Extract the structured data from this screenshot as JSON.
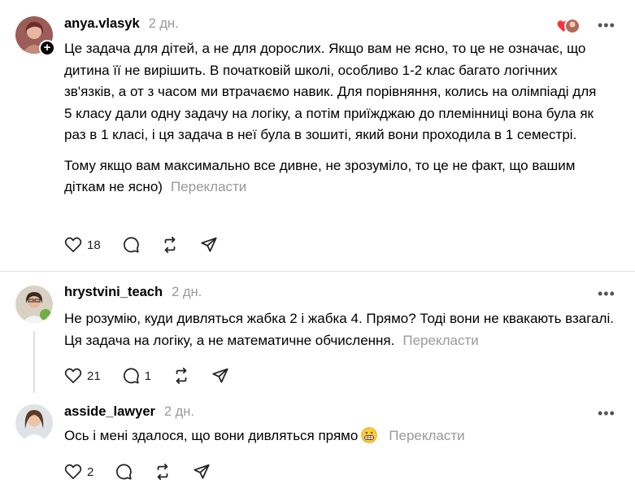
{
  "posts": [
    {
      "username": "anya.vlasyk",
      "time": "2 дн.",
      "paragraphs": [
        "Це задача для дітей, а не для дорослих. Якщо вам не ясно, то це не означає, що дитина її не вирішить. В початковій школі, особливо 1-2 клас багато логічних зв'язків, а от з часом ми втрачаємо навик. Для порівняння, колись на олімпіаді для 5 класу дали одну задачу на логіку, а потім приїжджаю до племінниці вона була як раз в 1 класі, і ця задача в неї була в зошиті, який вони проходила в 1 семестрі.",
        "Тому якщо вам максимально все дивне, не зрозуміло, то це не факт, що вашим діткам не ясно)"
      ],
      "translate": "Перекласти",
      "likes": "18",
      "replies": "",
      "more_icon": "more-horizontal-icon"
    },
    {
      "username": "hrystvini_teach",
      "time": "2 дн.",
      "paragraphs": [
        "Не розумію, куди дивляться жабка 2 і жабка 4. Прямо? Тоді вони не квакають взагалі. Ця задача на логіку, а не математичне обчислення."
      ],
      "translate": "Перекласти",
      "likes": "21",
      "replies": "1"
    },
    {
      "username": "asside_lawyer",
      "time": "2 дн.",
      "paragraphs": [
        "Ось і мені здалося, що вони дивляться прямо"
      ],
      "translate": "Перекласти",
      "likes": "2",
      "replies": ""
    }
  ],
  "colors": {
    "text": "#000000",
    "muted": "#999999",
    "divider": "#dcdcdc",
    "liked_heart": "#ff3040"
  },
  "icons": [
    "heart-icon",
    "comment-icon",
    "repost-icon",
    "share-icon",
    "plus-icon",
    "more-icon",
    "grimacing-emoji"
  ]
}
